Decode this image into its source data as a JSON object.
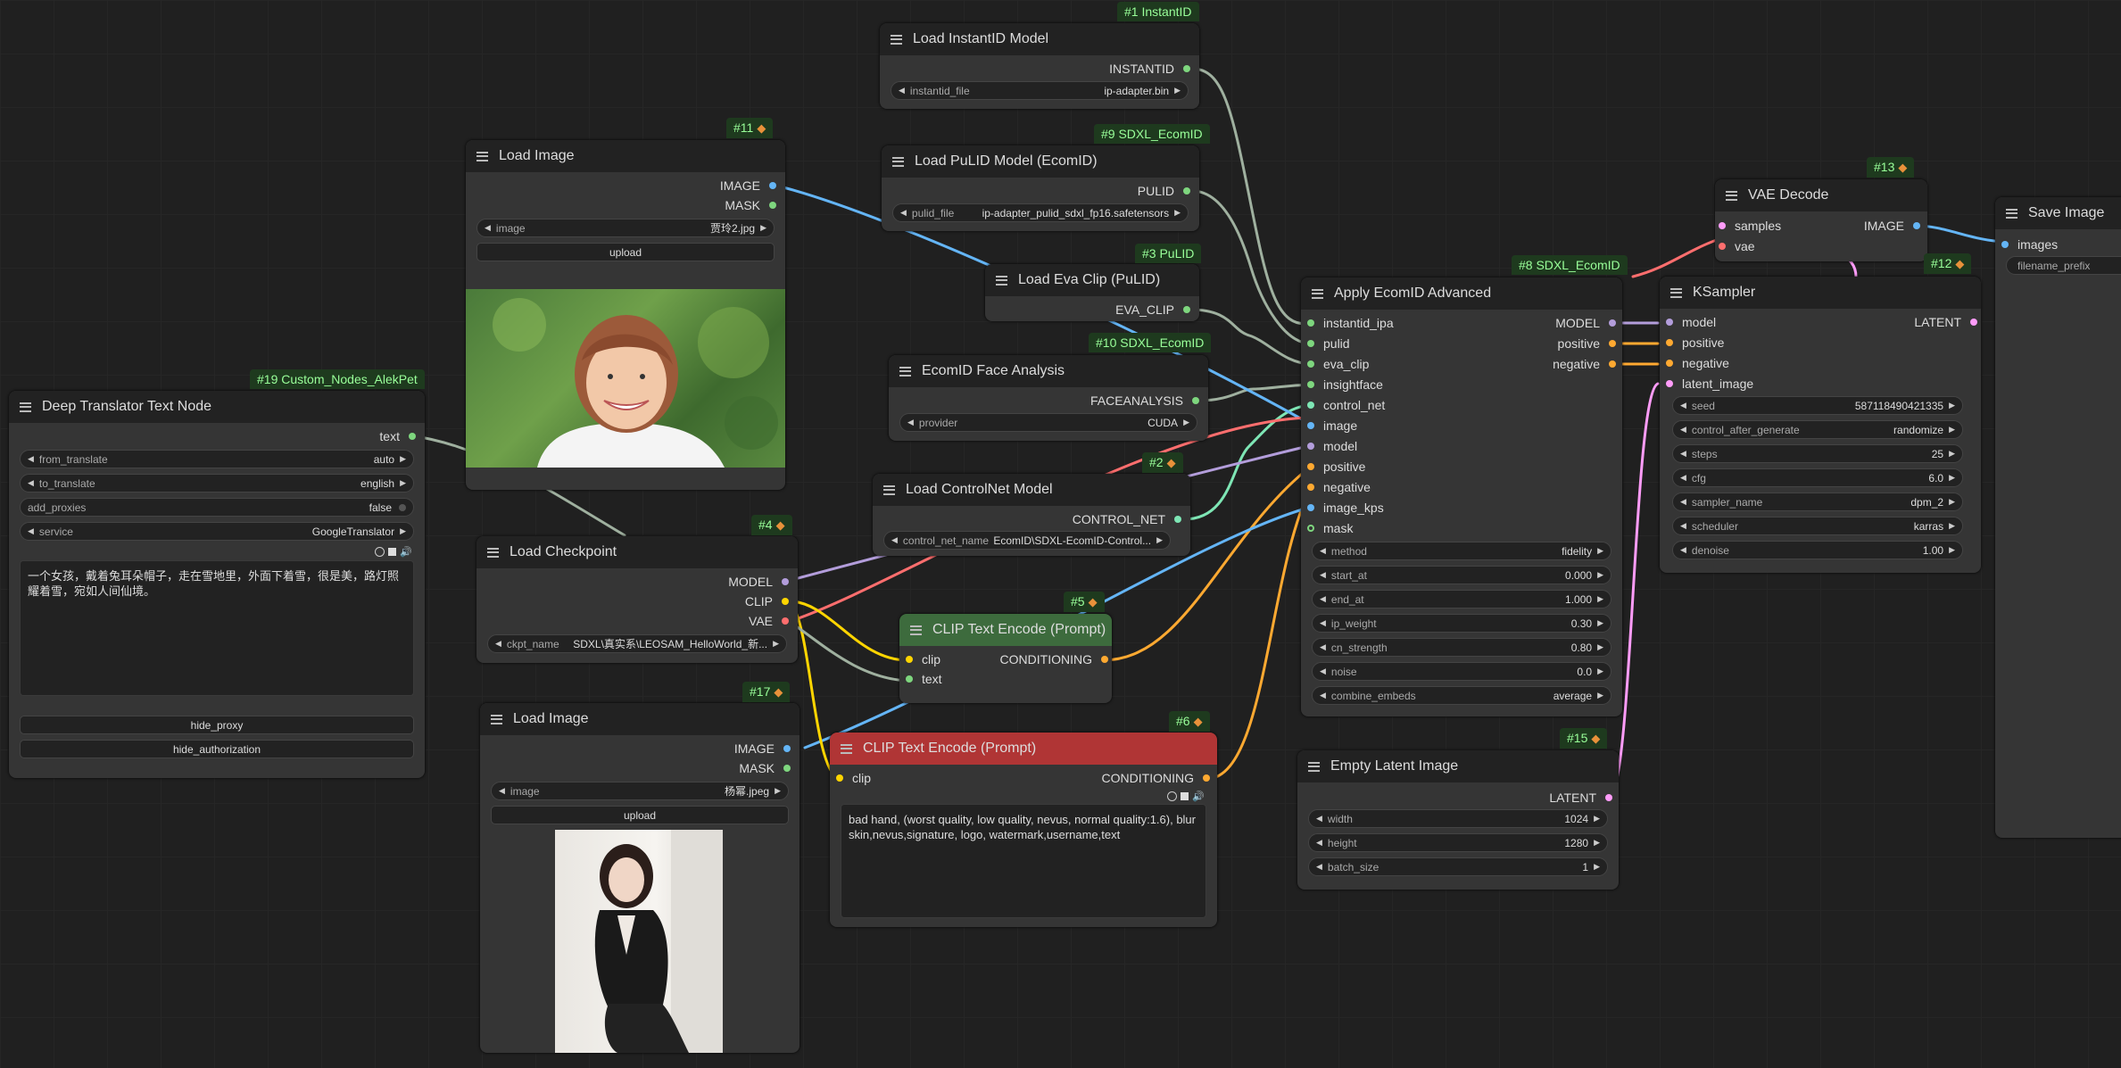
{
  "nodes": {
    "instantid_model": {
      "badge": "#1 InstantID",
      "title": "Load InstantID Model",
      "output": "INSTANTID",
      "widget_name": "instantid_file",
      "widget_value": "ip-adapter.bin"
    },
    "pulid_model": {
      "badge": "#9 SDXL_EcomID",
      "title": "Load PuLID Model (EcomID)",
      "output": "PULID",
      "widget_name": "pulid_file",
      "widget_value": "ip-adapter_pulid_sdxl_fp16.safetensors"
    },
    "eva_clip": {
      "badge": "#3 PuLID",
      "title": "Load Eva Clip (PuLID)",
      "output": "EVA_CLIP"
    },
    "face_analysis": {
      "badge": "#10 SDXL_EcomID",
      "title": "EcomID Face Analysis",
      "output": "FACEANALYSIS",
      "widget_name": "provider",
      "widget_value": "CUDA"
    },
    "controlnet": {
      "badge": "#2",
      "title": "Load ControlNet Model",
      "output": "CONTROL_NET",
      "widget_name": "control_net_name",
      "widget_value": "EcomID\\SDXL-EcomID-Control..."
    },
    "load_image_1": {
      "badge": "#11",
      "title": "Load Image",
      "outputs": [
        "IMAGE",
        "MASK"
      ],
      "widget_name": "image",
      "widget_value": "贾玲2.jpg",
      "upload": "upload"
    },
    "translator": {
      "badge": "#19 Custom_Nodes_AlekPet",
      "title": "Deep Translator Text Node",
      "output": "text",
      "widgets": [
        {
          "name": "from_translate",
          "value": "auto"
        },
        {
          "name": "to_translate",
          "value": "english"
        },
        {
          "name": "add_proxies",
          "value": "false"
        },
        {
          "name": "service",
          "value": "GoogleTranslator"
        }
      ],
      "text": "一个女孩，戴着兔耳朵帽子，走在雪地里，外面下着雪，很是美，路灯照耀着雪，宛如人间仙境。",
      "buttons": [
        "hide_proxy",
        "hide_authorization"
      ]
    },
    "checkpoint": {
      "badge": "#4",
      "title": "Load Checkpoint",
      "outputs": [
        "MODEL",
        "CLIP",
        "VAE"
      ],
      "widget_name": "ckpt_name",
      "widget_value": "SDXL\\真实系\\LEOSAM_HelloWorld_新..."
    },
    "load_image_2": {
      "badge": "#17",
      "title": "Load Image",
      "outputs": [
        "IMAGE",
        "MASK"
      ],
      "widget_name": "image",
      "widget_value": "杨幂.jpeg",
      "upload": "upload"
    },
    "clip_pos": {
      "badge": "#5",
      "title": "CLIP Text Encode (Prompt)",
      "inputs": [
        "clip",
        "text"
      ],
      "output": "CONDITIONING"
    },
    "clip_neg": {
      "badge": "#6",
      "title": "CLIP Text Encode (Prompt)",
      "input": "clip",
      "output": "CONDITIONING",
      "text": "bad hand, (worst quality, low quality, nevus, normal quality:1.6), blur skin,nevus,signature, logo, watermark,username,text"
    },
    "apply_ecomid": {
      "badge": "#8 SDXL_EcomID",
      "title": "Apply EcomID Advanced",
      "inputs": [
        "instantid_ipa",
        "pulid",
        "eva_clip",
        "insightface",
        "control_net",
        "image",
        "model",
        "positive",
        "negative",
        "image_kps",
        "mask"
      ],
      "outputs": [
        "MODEL",
        "positive",
        "negative"
      ],
      "widgets": [
        {
          "name": "method",
          "value": "fidelity"
        },
        {
          "name": "start_at",
          "value": "0.000"
        },
        {
          "name": "end_at",
          "value": "1.000"
        },
        {
          "name": "ip_weight",
          "value": "0.30"
        },
        {
          "name": "cn_strength",
          "value": "0.80"
        },
        {
          "name": "noise",
          "value": "0.0"
        },
        {
          "name": "combine_embeds",
          "value": "average"
        }
      ]
    },
    "empty_latent": {
      "badge": "#15",
      "title": "Empty Latent Image",
      "output": "LATENT",
      "widgets": [
        {
          "name": "width",
          "value": "1024"
        },
        {
          "name": "height",
          "value": "1280"
        },
        {
          "name": "batch_size",
          "value": "1"
        }
      ]
    },
    "vae_decode": {
      "badge": "#13",
      "title": "VAE Decode",
      "inputs": [
        "samples",
        "vae"
      ],
      "output": "IMAGE"
    },
    "ksampler": {
      "badge": "#12",
      "title": "KSampler",
      "inputs": [
        "model",
        "positive",
        "negative",
        "latent_image"
      ],
      "output": "LATENT",
      "widgets": [
        {
          "name": "seed",
          "value": "587118490421335"
        },
        {
          "name": "control_after_generate",
          "value": "randomize"
        },
        {
          "name": "steps",
          "value": "25"
        },
        {
          "name": "cfg",
          "value": "6.0"
        },
        {
          "name": "sampler_name",
          "value": "dpm_2"
        },
        {
          "name": "scheduler",
          "value": "karras"
        },
        {
          "name": "denoise",
          "value": "1.00"
        }
      ]
    },
    "save_image": {
      "title": "Save Image",
      "input": "images",
      "widget_value": "filename_prefix"
    }
  },
  "colors": {
    "image": "#64b5f6",
    "model": "#b39ddb",
    "clip": "#ffd500",
    "vae": "#ff6e6e",
    "conditioning": "#ffa931",
    "latent": "#ff9cf9",
    "green": "#7ed67e",
    "pos_header": "#3d6b3d",
    "neg_header": "#b03535"
  }
}
